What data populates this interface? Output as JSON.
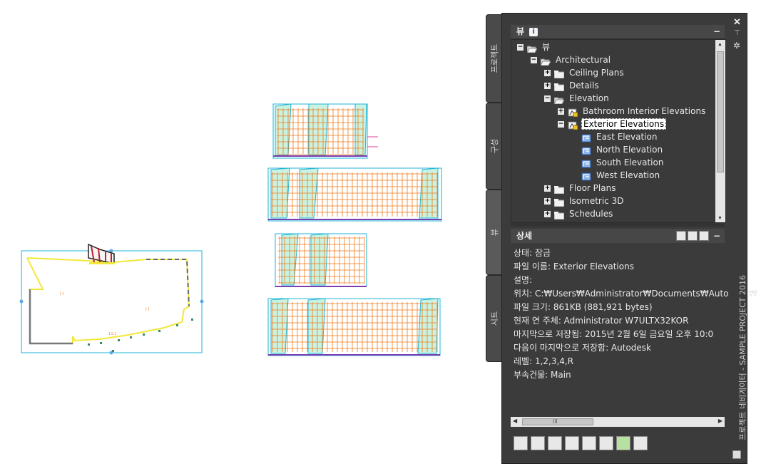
{
  "palette": {
    "tabs": [
      "프로젝트",
      "구성",
      "뷰",
      "시트"
    ],
    "strip_title": "프로젝트 네비게이터 - SAMPLE PROJECT 2016",
    "strip_icons": [
      "close-icon",
      "pin-icon",
      "settings-icon"
    ],
    "view_section": {
      "title": "뷰",
      "info_badge": "i",
      "collapse": "−"
    },
    "tree": [
      {
        "label": "뷰",
        "depth": 0,
        "expander": "−",
        "icon": "folder-open-icon"
      },
      {
        "label": "Architectural",
        "depth": 1,
        "expander": "−",
        "icon": "folder-open-icon"
      },
      {
        "label": "Ceiling Plans",
        "depth": 2,
        "expander": "+",
        "icon": "folder-icon"
      },
      {
        "label": "Details",
        "depth": 2,
        "expander": "+",
        "icon": "folder-icon"
      },
      {
        "label": "Elevation",
        "depth": 2,
        "expander": "−",
        "icon": "folder-open-icon"
      },
      {
        "label": "Bathroom Interior Elevations",
        "depth": 3,
        "expander": "+",
        "icon": "locked-drawing-icon"
      },
      {
        "label": "Exterior Elevations",
        "depth": 3,
        "expander": "−",
        "icon": "locked-drawing-icon",
        "selected": true
      },
      {
        "label": "East Elevation",
        "depth": 4,
        "expander": "",
        "icon": "view-icon"
      },
      {
        "label": "North Elevation",
        "depth": 4,
        "expander": "",
        "icon": "view-icon"
      },
      {
        "label": "South Elevation",
        "depth": 4,
        "expander": "",
        "icon": "view-icon"
      },
      {
        "label": "West Elevation",
        "depth": 4,
        "expander": "",
        "icon": "view-icon"
      },
      {
        "label": "Floor Plans",
        "depth": 2,
        "expander": "+",
        "icon": "folder-icon"
      },
      {
        "label": "Isometric 3D",
        "depth": 2,
        "expander": "+",
        "icon": "folder-icon"
      },
      {
        "label": "Schedules",
        "depth": 2,
        "expander": "+",
        "icon": "folder-icon"
      }
    ],
    "details_section": {
      "title": "상세",
      "collapse": "−"
    },
    "details": [
      "상태: 잠금",
      "파일 이름: Exterior Elevations",
      "설명:",
      "위치: C:₩Users₩Administrator₩Documents₩Autodesk₩",
      "파일 크기: 861KB (881,921 bytes)",
      "현재 연 주체: Administrator W7ULTX32KOR",
      "마지막으로 저장됨: 2015년 2월 6일 금요일  오후 10:0",
      "다음이 마지막으로 저장함: Autodesk",
      "레벨: 1,2,3,4,R",
      "부속건물: Main"
    ],
    "hscroll_grip": "III",
    "toolbar": [
      "new-view-icon",
      "add-view-icon",
      "regenerate-icon",
      "copy-icon",
      "pointer-icon",
      "table-icon",
      "refresh-icon",
      "repath-icon"
    ]
  },
  "colors": {
    "cyan": "#1eb6d8",
    "orange": "#f07a1a",
    "yellow": "#f2e83a",
    "green": "#58c46a",
    "magenta": "#e0409a",
    "panel": "#3b3b3b"
  }
}
